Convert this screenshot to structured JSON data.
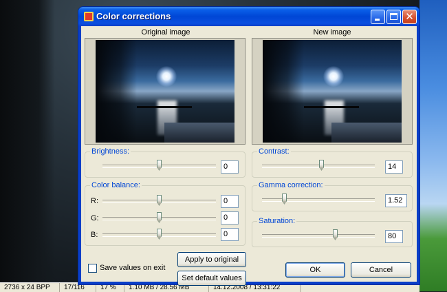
{
  "dialog": {
    "title": "Color corrections"
  },
  "images": {
    "original_label": "Original image",
    "new_label": "New image"
  },
  "brightness": {
    "label": "Brightness:",
    "value": "0",
    "slider_fraction": 0.5
  },
  "contrast": {
    "label": "Contrast:",
    "value": "14",
    "slider_fraction": 0.53
  },
  "color_balance": {
    "label": "Color balance:",
    "channels": [
      {
        "label": "R:",
        "value": "0",
        "slider_fraction": 0.5
      },
      {
        "label": "G:",
        "value": "0",
        "slider_fraction": 0.5
      },
      {
        "label": "B:",
        "value": "0",
        "slider_fraction": 0.5
      }
    ]
  },
  "gamma": {
    "label": "Gamma correction:",
    "value": "1.52",
    "slider_fraction": 0.2
  },
  "saturation": {
    "label": "Saturation:",
    "value": "80",
    "slider_fraction": 0.65
  },
  "buttons": {
    "apply_to_original": "Apply to original",
    "set_default_values": "Set default values",
    "ok": "OK",
    "cancel": "Cancel"
  },
  "save_values": {
    "label": "Save values on exit",
    "checked": false
  },
  "statusbar": {
    "cells": [
      "2736 x 24 BPP",
      "17/116",
      "17 %",
      "1.10 MB / 28.56 MB",
      "14.12.2008 / 13:31:22"
    ]
  }
}
